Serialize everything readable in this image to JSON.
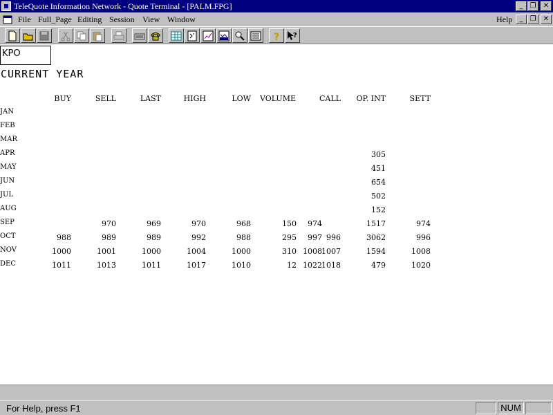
{
  "window": {
    "title": "TeleQuote Information Network - Quote Terminal - [PALM.FPG]"
  },
  "menu": {
    "items": [
      "File",
      "Full_Page",
      "Editing",
      "Session",
      "View",
      "Window"
    ],
    "help": "Help"
  },
  "toolbar": {
    "icons": [
      "new-icon",
      "open-icon",
      "save-icon",
      "cut-icon",
      "copy-icon",
      "paste-icon",
      "print-icon",
      "keyboard-icon",
      "phone-icon",
      "grid-icon",
      "calculator-icon",
      "chart-icon",
      "live-icon",
      "zoom-icon",
      "page-icon",
      "help-icon",
      "context-help-icon"
    ]
  },
  "quote": {
    "symbol": "KPO",
    "period": "CURRENT  YEAR",
    "headers": [
      "BUY",
      "SELL",
      "LAST",
      "HIGH",
      "LOW",
      "VOLUME",
      "CALL",
      "OP. INT",
      "SETT"
    ],
    "rows": [
      {
        "month": "JAN",
        "buy": "",
        "sell": "",
        "last": "",
        "high": "",
        "low": "",
        "volume": "",
        "call": "",
        "call2": "",
        "opint": "",
        "sett": ""
      },
      {
        "month": "FEB",
        "buy": "",
        "sell": "",
        "last": "",
        "high": "",
        "low": "",
        "volume": "",
        "call": "",
        "call2": "",
        "opint": "",
        "sett": ""
      },
      {
        "month": "MAR",
        "buy": "",
        "sell": "",
        "last": "",
        "high": "",
        "low": "",
        "volume": "",
        "call": "",
        "call2": "",
        "opint": "",
        "sett": ""
      },
      {
        "month": "APR",
        "buy": "",
        "sell": "",
        "last": "",
        "high": "",
        "low": "",
        "volume": "",
        "call": "",
        "call2": "",
        "opint": "305",
        "sett": ""
      },
      {
        "month": "MAY",
        "buy": "",
        "sell": "",
        "last": "",
        "high": "",
        "low": "",
        "volume": "",
        "call": "",
        "call2": "",
        "opint": "451",
        "sett": ""
      },
      {
        "month": "JUN",
        "buy": "",
        "sell": "",
        "last": "",
        "high": "",
        "low": "",
        "volume": "",
        "call": "",
        "call2": "",
        "opint": "654",
        "sett": ""
      },
      {
        "month": "JUL",
        "buy": "",
        "sell": "",
        "last": "",
        "high": "",
        "low": "",
        "volume": "",
        "call": "",
        "call2": "",
        "opint": "502",
        "sett": ""
      },
      {
        "month": "AUG",
        "buy": "",
        "sell": "",
        "last": "",
        "high": "",
        "low": "",
        "volume": "",
        "call": "",
        "call2": "",
        "opint": "152",
        "sett": ""
      },
      {
        "month": "SEP",
        "buy": "",
        "sell": "970",
        "last": "969",
        "high": "970",
        "low": "968",
        "volume": "150",
        "call": "974",
        "call2": "",
        "opint": "1517",
        "sett": "974"
      },
      {
        "month": "OCT",
        "buy": "988",
        "sell": "989",
        "last": "989",
        "high": "992",
        "low": "988",
        "volume": "295",
        "call": "997",
        "call2": "996",
        "opint": "3062",
        "sett": "996"
      },
      {
        "month": "NOV",
        "buy": "1000",
        "sell": "1001",
        "last": "1000",
        "high": "1004",
        "low": "1000",
        "volume": "310",
        "call": "1008",
        "call2": "1007",
        "opint": "1594",
        "sett": "1008"
      },
      {
        "month": "DEC",
        "buy": "1011",
        "sell": "1013",
        "last": "1011",
        "high": "1017",
        "low": "1010",
        "volume": "12",
        "call": "1022",
        "call2": "1018",
        "opint": "479",
        "sett": "1020"
      }
    ]
  },
  "status": {
    "help_text": "For Help, press F1",
    "num": "NUM"
  }
}
